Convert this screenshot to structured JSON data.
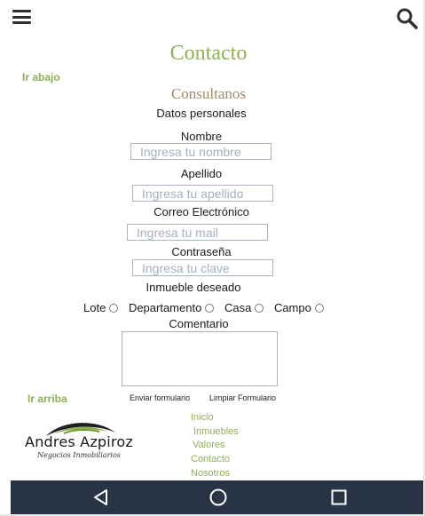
{
  "header": {
    "menu_icon": "hamburger-icon",
    "search_icon": "search-icon"
  },
  "page": {
    "title": "Contacto",
    "subtitle": "Consultanos",
    "section_label": "Datos personales"
  },
  "links": {
    "go_down": "Ir abajo",
    "go_up": "Ir arriba"
  },
  "form": {
    "name_label": "Nombre",
    "name_placeholder": "Ingresa tu nombre",
    "lastname_label": "Apellido",
    "lastname_placeholder": "Ingresa tu apellido",
    "email_label": "Correo Electrónico",
    "email_placeholder": "Ingresa tu mail",
    "password_label": "Contraseña",
    "password_placeholder": "Ingresa tu clave",
    "property_label": "Inmueble deseado",
    "options": [
      "Lote",
      "Departamento",
      "Casa",
      "Campo"
    ],
    "comment_label": "Comentario",
    "submit_label": "Enviar formulario",
    "reset_label": "Limpiar Formulario"
  },
  "brand": {
    "name": "Andres Azpiroz",
    "tagline": "Negocios Inmobiliarios"
  },
  "footer": {
    "links": [
      "Inicio",
      "Inmuebles",
      "Valores",
      "Contacto",
      "Nosotros"
    ]
  },
  "colors": {
    "accent": "#8fb053",
    "subtitle": "#a08a6b",
    "navbar": "#283445"
  },
  "navbar": {
    "back_icon": "back-triangle-icon",
    "home_icon": "home-circle-icon",
    "recents_icon": "recents-square-icon"
  }
}
